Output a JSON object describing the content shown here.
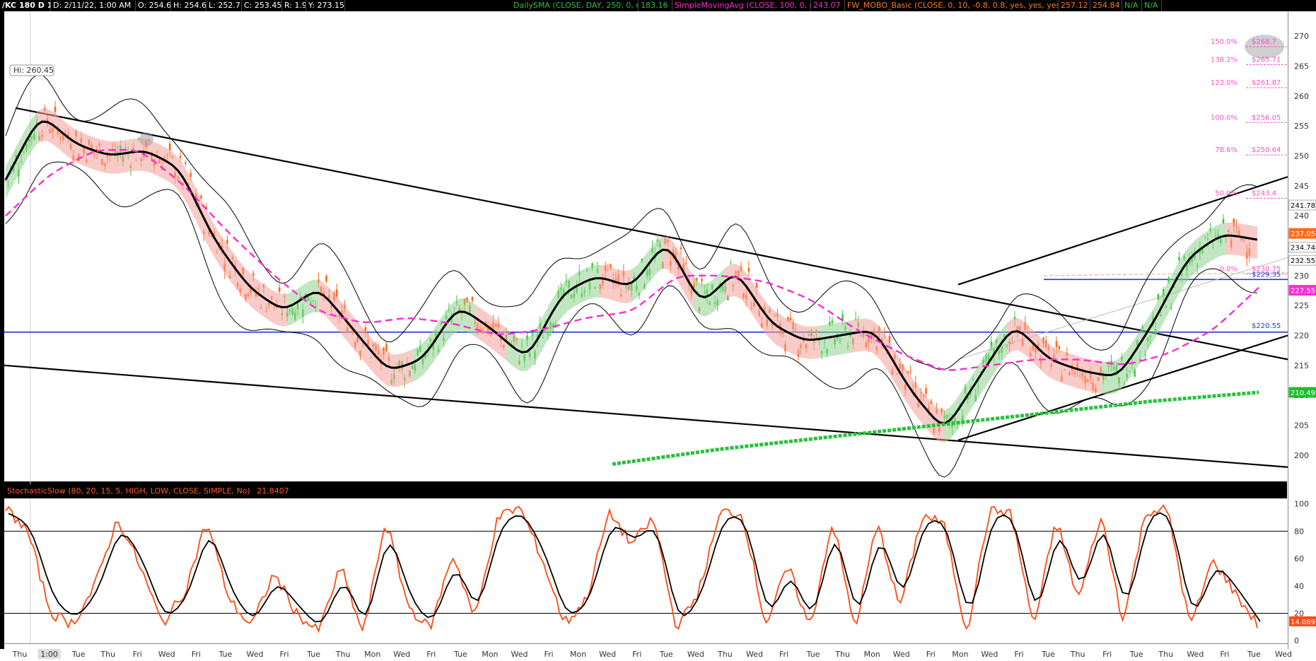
{
  "header": {
    "symbol": "/KC 180 D 1h",
    "date": "D: 2/11/22, 1:00 AM",
    "open": "O: 254.6",
    "high": "H: 254.6",
    "low": "L: 252.7",
    "close": "C: 253.45",
    "range": "R: 1.9",
    "y": "Y: 273.15",
    "study1": "DailySMA (CLOSE, DAY, 250, 0, no)",
    "study1_value": "183.16",
    "study2": "SimpleMovingAvg (CLOSE, 100, 0, no)",
    "study2_value": "243.07",
    "study3": "FW_MOBO_Basic (CLOSE, 0, 10, -0.8, 0.8, yes, yes, yes, yes)",
    "study3_value1": "257.12",
    "study3_value2": "254.84",
    "na1": "N/A",
    "na2": "N/A"
  },
  "hi_label": "Hi: 260.45",
  "stoch_label": "StochasticSlow (80, 20, 15, 5, HIGH, LOW, CLOSE, SIMPLE, No)",
  "stoch_value": "21.8407",
  "fib_levels": [
    {
      "pct": "150.0%",
      "price": "$268.7"
    },
    {
      "pct": "138.2%",
      "price": "$265.71"
    },
    {
      "pct": "123.0%",
      "price": "$261.87"
    },
    {
      "pct": "100.0%",
      "price": "$256.05"
    },
    {
      "pct": "78.6%",
      "price": "$250.64"
    },
    {
      "pct": "50.0%",
      "price": "$243.4"
    },
    {
      "pct": "0.0%",
      "price": "$230.75"
    }
  ],
  "hline_labels": [
    "$229.35",
    "$220.55"
  ],
  "price_badges": [
    {
      "text": "241.78",
      "bg": "#ffffff",
      "fg": "#000000"
    },
    {
      "text": "237.05",
      "bg": "#ff6a1a",
      "fg": "#ffffff"
    },
    {
      "text": "234.74",
      "bg": "#ffffff",
      "fg": "#000000"
    },
    {
      "text": "232.55",
      "bg": "#ffffff",
      "fg": "#000000"
    },
    {
      "text": "227.55",
      "bg": "#ff2bd1",
      "fg": "#ffffff"
    },
    {
      "text": "210.49",
      "bg": "#1fbe32",
      "fg": "#ffffff"
    }
  ],
  "stoch_badge": "14.089",
  "colors": {
    "up": "#3ec63e",
    "down": "#ff6a1a",
    "sma100": "#ff2bd1",
    "sma250": "#27c23a",
    "hline": "#1a3ccc",
    "bullish_band": "#8fd18f",
    "bearish_band": "#f2a09a"
  },
  "chart_data": {
    "type": "line",
    "price_axis": {
      "ticks": [
        270,
        265,
        260,
        255,
        250,
        245,
        240,
        235,
        230,
        225,
        220,
        215,
        210,
        205,
        200
      ],
      "ylim": [
        197.5,
        272.5
      ]
    },
    "stoch_axis": {
      "ticks": [
        100,
        80,
        60,
        40,
        20,
        0
      ],
      "ylim": [
        -2,
        104
      ]
    },
    "x_labels": [
      "Thu",
      "1:00",
      "Tue",
      "Thu",
      "Fri",
      "Wed",
      "Fri",
      "Tue",
      "Wed",
      "Fri",
      "Tue",
      "Thu",
      "Mon",
      "Wed",
      "Fri",
      "Tue",
      "Mon",
      "Wed",
      "Fri",
      "Mon",
      "Wed",
      "Fri",
      "Tue",
      "Wed",
      "Thu",
      "Wed",
      "Fri",
      "Tue",
      "Thu",
      "Mon",
      "Wed",
      "Fri",
      "Mon",
      "Wed",
      "Fri",
      "Tue",
      "Thu",
      "Fri",
      "Tue",
      "Thu",
      "Wed",
      "Fri",
      "Tue",
      "Wed"
    ],
    "series": [
      {
        "name": "SMA",
        "values": [
          246,
          257,
          252,
          250,
          251,
          248,
          236,
          228,
          224,
          228,
          221,
          214,
          216,
          225,
          221,
          216,
          227,
          230,
          228,
          236,
          225,
          231,
          222,
          219,
          220,
          221,
          211,
          204,
          213,
          222,
          216,
          214,
          213,
          222,
          233,
          237,
          236
        ]
      },
      {
        "name": "SimpleMovingAvg",
        "values": [
          240,
          247,
          251,
          251,
          245,
          237,
          230,
          224,
          222,
          223,
          222,
          220,
          221,
          223,
          224,
          230,
          230,
          229,
          226,
          221,
          217,
          214,
          215,
          216,
          216,
          215,
          217,
          221,
          228
        ]
      },
      {
        "name": "DailySMA",
        "values": [
          198.5,
          201,
          203,
          205,
          207,
          209,
          210.5
        ]
      },
      {
        "name": "Stochastic K",
        "values": [
          97,
          80,
          20,
          12,
          40,
          90,
          55,
          12,
          35,
          88,
          30,
          10,
          50,
          20,
          6,
          55,
          3,
          90,
          25,
          8,
          65,
          15,
          90,
          98,
          60,
          12,
          30,
          95,
          70,
          90,
          8,
          35,
          95,
          92,
          10,
          55,
          8,
          90,
          6,
          88,
          22,
          92,
          85,
          4,
          95,
          94,
          8,
          90,
          28,
          93,
          12,
          95,
          96,
          8,
          60,
          35,
          12
        ]
      },
      {
        "name": "Stochastic D",
        "values": [
          93,
          85,
          30,
          15,
          35,
          85,
          60,
          15,
          30,
          85,
          35,
          12,
          45,
          25,
          8,
          50,
          6,
          85,
          30,
          10,
          60,
          18,
          85,
          95,
          65,
          15,
          28,
          90,
          72,
          88,
          10,
          32,
          92,
          90,
          12,
          52,
          10,
          88,
          8,
          85,
          25,
          90,
          86,
          6,
          92,
          93,
          10,
          88,
          30,
          92,
          14,
          93,
          95,
          10,
          58,
          38,
          14
        ]
      }
    ]
  }
}
